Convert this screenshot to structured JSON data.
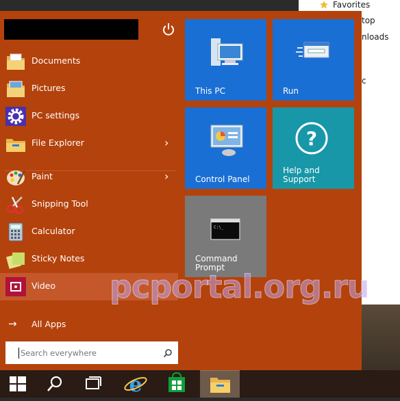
{
  "background_window": {
    "favorites": "Favorites",
    "row2": "top",
    "row3": "nloads",
    "row4": "c"
  },
  "start_menu": {
    "user_name": "",
    "items": [
      {
        "label": "Documents",
        "icon": "documents-folder-icon"
      },
      {
        "label": "Pictures",
        "icon": "pictures-folder-icon"
      },
      {
        "label": "PC settings",
        "icon": "gear-icon"
      },
      {
        "label": "File Explorer",
        "icon": "file-explorer-icon",
        "has_submenu": true
      },
      {
        "label": "Paint",
        "icon": "paint-palette-icon",
        "has_submenu": true
      },
      {
        "label": "Snipping Tool",
        "icon": "scissors-icon"
      },
      {
        "label": "Calculator",
        "icon": "calculator-icon"
      },
      {
        "label": "Sticky Notes",
        "icon": "sticky-notes-icon"
      },
      {
        "label": "Video",
        "icon": "video-icon",
        "highlighted": true
      }
    ],
    "all_apps": "All Apps",
    "search_placeholder": "Search everywhere",
    "tiles": [
      {
        "label": "This PC",
        "color": "#1a6fd4",
        "icon": "computer-icon"
      },
      {
        "label": "Run",
        "color": "#1a6fd4",
        "icon": "run-icon"
      },
      {
        "label": "Control Panel",
        "color": "#1a6fd4",
        "icon": "control-panel-icon"
      },
      {
        "label": "Help and Support",
        "color": "#1797a8",
        "icon": "help-icon"
      },
      {
        "label": "Command Prompt",
        "color": "#7a7a7a",
        "icon": "command-prompt-icon"
      }
    ],
    "accent_color": "#b4420c"
  },
  "taskbar": {
    "buttons": [
      "windows-start-icon",
      "search-icon",
      "task-view-icon",
      "internet-explorer-icon",
      "store-icon",
      "file-explorer-icon"
    ]
  },
  "watermark": "pcportal.org.ru"
}
